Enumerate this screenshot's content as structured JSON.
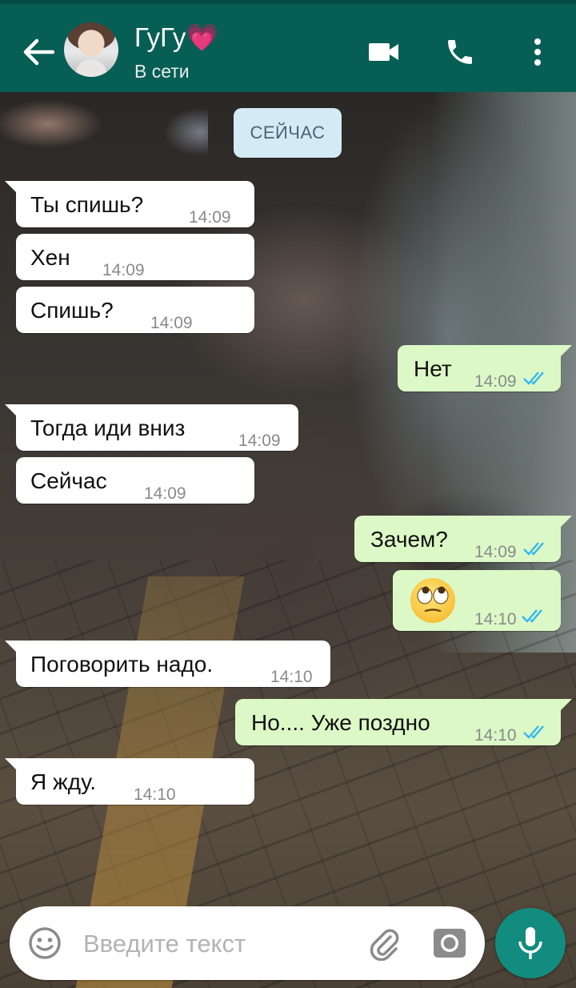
{
  "header": {
    "contact_name": "ГуГу💗",
    "status": "В сети",
    "icons": [
      "back-arrow-icon",
      "video-camera-icon",
      "phone-icon",
      "more-vert-icon"
    ]
  },
  "date_chip": "СЕЙЧАС",
  "messages": [
    {
      "direction": "in",
      "text": "Ты спишь?",
      "time": "14:09"
    },
    {
      "direction": "in",
      "text": "Хен",
      "time": "14:09"
    },
    {
      "direction": "in",
      "text": "Спишь?",
      "time": "14:09"
    },
    {
      "direction": "out",
      "text": "Нет",
      "time": "14:09",
      "read": true
    },
    {
      "direction": "in",
      "text": "Тогда иди вниз",
      "time": "14:09"
    },
    {
      "direction": "in",
      "text": "Сейчас",
      "time": "14:09"
    },
    {
      "direction": "out",
      "text": "Зачем?",
      "time": "14:09",
      "read": true
    },
    {
      "direction": "out",
      "text": "🙄",
      "time": "14:10",
      "read": true,
      "emoji": "face-with-rolling-eyes"
    },
    {
      "direction": "in",
      "text": "Поговорить надо.",
      "time": "14:10"
    },
    {
      "direction": "out",
      "text": "Но.... Уже поздно",
      "time": "14:10",
      "read": true
    },
    {
      "direction": "in",
      "text": "Я жду.",
      "time": "14:10"
    }
  ],
  "composer": {
    "placeholder": "Введите текст",
    "icons": [
      "emoji-icon",
      "attach-icon",
      "camera-icon",
      "mic-icon"
    ]
  },
  "colors": {
    "header": "#075e54",
    "outgoing_bubble": "#dcf8c6",
    "incoming_bubble": "#ffffff",
    "read_ticks": "#34b7f1",
    "mic_button": "#128c7e"
  }
}
